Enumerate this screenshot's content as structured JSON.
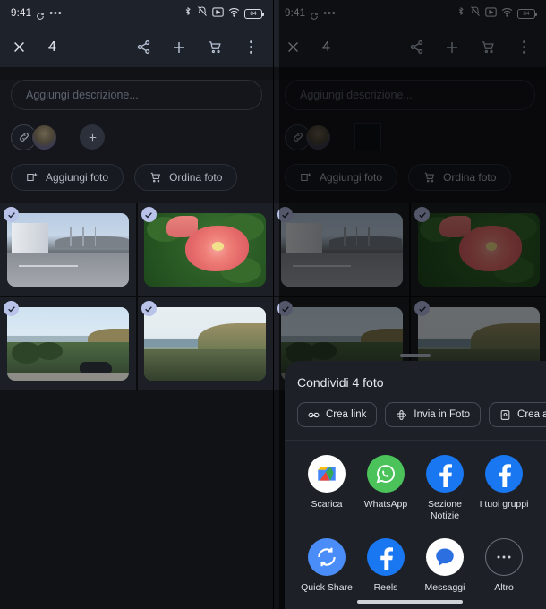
{
  "status_bar": {
    "time": "9:41",
    "icons": [
      "sync-icon",
      "more-icon",
      "bluetooth-icon",
      "vibrate-off-icon",
      "cast-icon",
      "wifi-icon",
      "battery-icon"
    ],
    "battery_level": "84"
  },
  "app_bar": {
    "close_label": "×",
    "selection_count": "4",
    "actions": [
      "share-icon",
      "add-icon",
      "cart-icon",
      "overflow-icon"
    ]
  },
  "composer": {
    "description_placeholder": "Aggiungi descrizione...",
    "add_person_label": "+",
    "buttons": [
      {
        "label": "Aggiungi foto",
        "icon": "add-photo-icon"
      },
      {
        "label": "Ordina foto",
        "icon": "cart-icon"
      }
    ]
  },
  "grid": {
    "photos": [
      {
        "id": "photo-street",
        "alt": "Strada con edificio bianco",
        "selected": true
      },
      {
        "id": "photo-flower",
        "alt": "Fiore rosa su foglie verdi",
        "selected": true
      },
      {
        "id": "photo-overlook",
        "alt": "Panorama collina sul mare con auto",
        "selected": true
      },
      {
        "id": "photo-headland",
        "alt": "Promontorio sul mare",
        "selected": true
      }
    ]
  },
  "share_sheet": {
    "title": "Condividi 4 foto",
    "chips": [
      {
        "label": "Crea link",
        "icon": "link-icon"
      },
      {
        "label": "Invia in Foto",
        "icon": "photos-icon"
      },
      {
        "label": "Crea album",
        "icon": "album-icon"
      }
    ],
    "apps_row_1": [
      {
        "label": "Scarica",
        "icon": "files-icon"
      },
      {
        "label": "WhatsApp",
        "icon": "whatsapp-icon"
      },
      {
        "label": "Sezione Notizie",
        "icon": "facebook-icon"
      },
      {
        "label": "I tuoi gruppi",
        "icon": "facebook-icon"
      }
    ],
    "apps_row_2": [
      {
        "label": "Quick Share",
        "icon": "quick-share-icon"
      },
      {
        "label": "Reels",
        "icon": "facebook-icon"
      },
      {
        "label": "Messaggi",
        "icon": "messages-icon"
      },
      {
        "label": "Altro",
        "icon": "more-horizontal-icon"
      }
    ]
  },
  "colors": {
    "app_bar": "#1e222a",
    "body": "#14161b",
    "sheet": "#1d2127",
    "accent_icon": "#b8c4d6",
    "check_badge": "#b9c2e8"
  }
}
